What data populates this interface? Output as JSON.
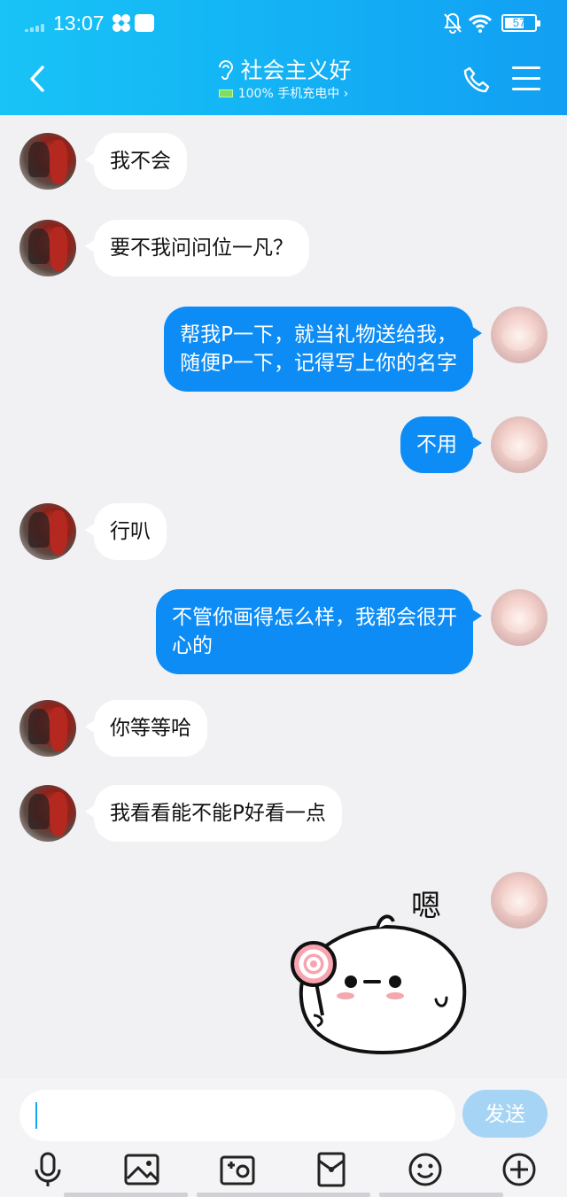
{
  "status": {
    "time": "13:07",
    "battery": "57"
  },
  "header": {
    "title": "社会主义好",
    "subtitle": "100% 手机充电中 ›"
  },
  "messages": [
    {
      "from": "them",
      "text": "我不会"
    },
    {
      "from": "them",
      "text": "要不我问问位一凡？"
    },
    {
      "from": "me",
      "text": "帮我P一下，就当礼物送给我，\n随便P一下，记得写上你的名字"
    },
    {
      "from": "me",
      "text": "不用"
    },
    {
      "from": "them",
      "text": "行叭"
    },
    {
      "from": "me",
      "text": "不管你画得怎么样，我都会很开\n心的"
    },
    {
      "from": "them",
      "text": "你等等哈"
    },
    {
      "from": "them",
      "text": "我看看能不能P好看一点"
    }
  ],
  "sticker": {
    "caption": "嗯"
  },
  "input": {
    "value": "",
    "send_label": "发送"
  },
  "colors": {
    "header": "#14b6f5",
    "my_bubble": "#0e8cf5",
    "send_button": "#a6d4f5"
  },
  "toolbar": {
    "icons": [
      "microphone-icon",
      "image-icon",
      "camera-icon",
      "red-envelope-icon",
      "emoji-icon",
      "plus-icon"
    ]
  }
}
